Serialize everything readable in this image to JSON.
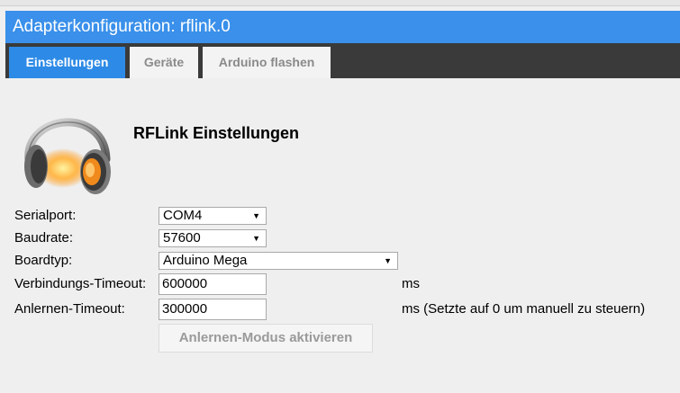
{
  "window": {
    "title": "Adapterkonfiguration: rflink.0"
  },
  "tabs": [
    {
      "label": "Einstellungen",
      "active": true
    },
    {
      "label": "Geräte",
      "active": false
    },
    {
      "label": "Arduino flashen",
      "active": false
    }
  ],
  "settings": {
    "heading": "RFLink Einstellungen",
    "serialport": {
      "label": "Serialport:",
      "value": "COM4"
    },
    "baudrate": {
      "label": "Baudrate:",
      "value": "57600"
    },
    "boardtyp": {
      "label": "Boardtyp:",
      "value": "Arduino Mega"
    },
    "verbindungs_timeout": {
      "label": "Verbindungs-Timeout:",
      "value": "600000",
      "unit": "ms"
    },
    "anlernen_timeout": {
      "label": "Anlernen-Timeout:",
      "value": "300000",
      "unit": "ms (Setzte auf 0 um manuell zu steuern)"
    },
    "anlernen_button": "Anlernen-Modus aktivieren"
  },
  "colors": {
    "accent": "#3a90ea",
    "tab_bar": "#3a3a3a",
    "background": "#efefef"
  },
  "icons": {
    "logo": "headphones-icon",
    "dropdown": "caret-down-icon"
  }
}
